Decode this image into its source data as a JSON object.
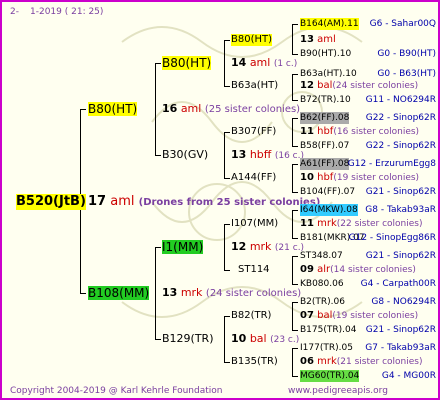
{
  "header": {
    "left": "2-",
    "right": "1-2019 ( 21: 25)"
  },
  "footer": {
    "left": "Copyright 2004-2019 @ Karl Kehrle Foundation",
    "right": "www.pedigreeapis.org"
  },
  "watermark": "PedigreeApis",
  "root": {
    "label": "B520(JtB)",
    "num": "17",
    "abbr": "aml",
    "desc": "(Drones from 25 sister colonies)"
  },
  "gen1": [
    {
      "label": "B80(HT)",
      "num": "16",
      "abbr": "aml",
      "desc": "(25 sister colonies)"
    },
    {
      "label": "B108(MM)",
      "num": "13",
      "abbr": "mrk",
      "desc": "(24 sister colonies)"
    }
  ],
  "gen2": [
    {
      "label": "B80(HT)",
      "num": "14",
      "abbr": "aml",
      "desc": "(1 c.)"
    },
    {
      "label": "B30(GV)",
      "num": "13",
      "abbr": "hbff",
      "desc": "(16 c.)"
    },
    {
      "label": "I1(MM)",
      "num": "12",
      "abbr": "mrk",
      "desc": "(21 c.)"
    },
    {
      "label": "B129(TR)",
      "num": "10",
      "abbr": "bal",
      "desc": "(23 c.)"
    }
  ],
  "gen3": [
    {
      "label": "B80(HT)",
      "num": "13",
      "abbr": "aml",
      "desc": ""
    },
    {
      "label": "B63a(HT)",
      "num": "12",
      "abbr": "bal",
      "desc": "(24 sister colonies)"
    },
    {
      "label": "B307(FF)",
      "num": "11",
      "abbr": "hbf",
      "desc": "(16 sister colonies)"
    },
    {
      "label": "A144(FF)",
      "num": "10",
      "abbr": "hbf",
      "desc": "(19 sister colonies)"
    },
    {
      "label": "I107(MM)",
      "num": "11",
      "abbr": "mrk",
      "desc": "(22 sister colonies)"
    },
    {
      "label": "ST114",
      "num": "09",
      "abbr": "alr",
      "desc": "(14 sister colonies)"
    },
    {
      "label": "B82(TR)",
      "num": "07",
      "abbr": "bal",
      "desc": "(19 sister colonies)"
    },
    {
      "label": "B135(TR)",
      "num": "06",
      "abbr": "mrk",
      "desc": "(21 sister colonies)"
    }
  ],
  "gen4": [
    {
      "label": "B164(AM).11",
      "code": "G6 - Sahar00Q"
    },
    {
      "label": "B90(HT).10",
      "code": "G0 - B90(HT)"
    },
    {
      "label": "B63a(HT).10",
      "code": "G0 - B63(HT)"
    },
    {
      "label": "B72(TR).10",
      "code": "G11 - NO6294R"
    },
    {
      "label": "B62(FF).08",
      "code": "G22 - Sinop62R"
    },
    {
      "label": "B58(FF).07",
      "code": "G22 - Sinop62R"
    },
    {
      "label": "A61(FF).08",
      "code": "G12 - ErzurumEgg8"
    },
    {
      "label": "B104(FF).07",
      "code": "G21 - Sinop62R"
    },
    {
      "label": "I64(MKW).08",
      "code": "G8 - Takab93aR"
    },
    {
      "label": "B181(MKR).07",
      "code": "G12 - SinopEgg86R"
    },
    {
      "label": "ST348.07",
      "code": "G21 - Sinop62R"
    },
    {
      "label": "KB080.06",
      "code": "G4 - Carpath00R"
    },
    {
      "label": "B2(TR).06",
      "code": "G8 - NO6294R"
    },
    {
      "label": "B175(TR).04",
      "code": "G21 - Sinop62R"
    },
    {
      "label": "I177(TR).05",
      "code": "G7 - Takab93aR"
    },
    {
      "label": "MG60(TR).04",
      "code": "G4 - MG00R"
    }
  ],
  "colors": {
    "frame": "#cc00cc",
    "highlight_yellow": "#ffff00",
    "highlight_green": "#22cc22",
    "highlight_gray": "#aaaaaa",
    "highlight_cyan": "#33ccff",
    "highlight_lightgreen": "#66dd44"
  }
}
